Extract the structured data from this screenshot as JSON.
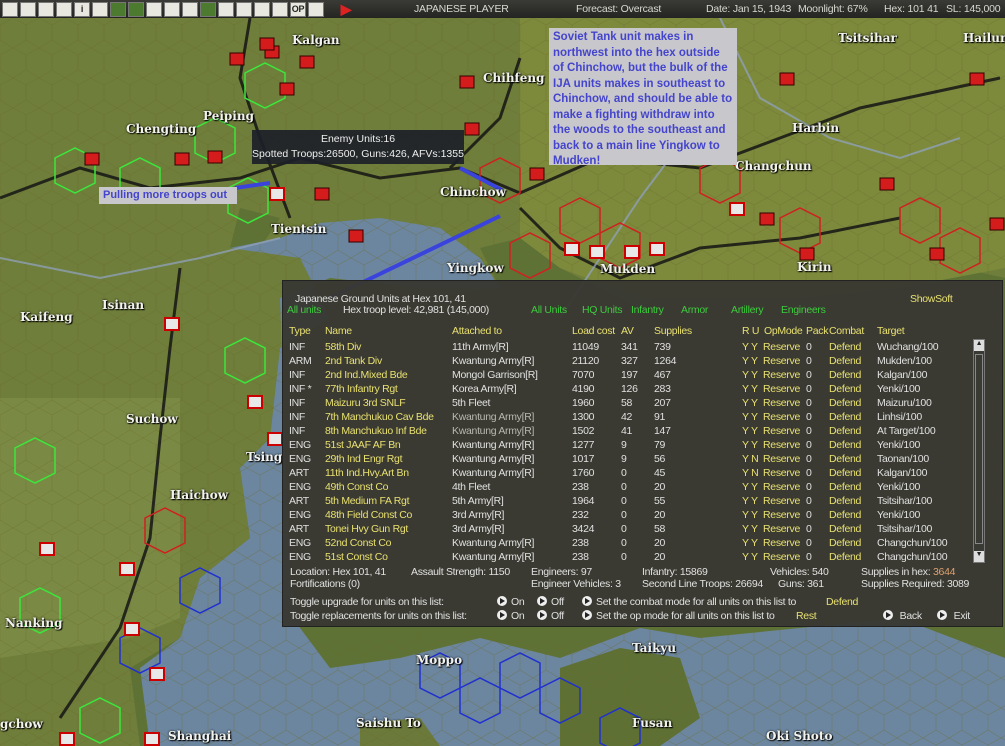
{
  "topbar": {
    "player": "JAPANESE PLAYER",
    "forecast": "Forecast: Overcast",
    "date": "Date: Jan 15, 1943",
    "moonlight": "Moonlight: 67%",
    "hex": "Hex: 101 41",
    "sl": "SL: 145,000",
    "buttons": [
      "unit-list",
      "report",
      "intel",
      "ships",
      "info",
      "japan-flag",
      "air-red",
      "air-blue",
      "flag",
      "infantry",
      "officer",
      "factory",
      "bases",
      "globe",
      "map",
      "op-report",
      "list",
      "cloud",
      "end-turn"
    ]
  },
  "map": {
    "cities": [
      "Kalgan",
      "Chihfeng",
      "Tsitsihar",
      "Hailun",
      "Peiping",
      "Chengting",
      "Harbin",
      "Changchun",
      "Chinchow",
      "Tientsin",
      "Yingkow",
      "Mukden",
      "Kirin",
      "Kaifeng",
      "Isinan",
      "Suchow",
      "Tsing",
      "Haichow",
      "Nanking",
      "Moppo",
      "Taikyu",
      "Saishu To",
      "Fusan",
      "Oki Shoto",
      "Shanghai",
      "gchow"
    ],
    "tooltip": {
      "line1": "Enemy Units:16",
      "line2": "Spotted Troops:26500, Guns:426, AFVs:1355"
    },
    "note_main": "Soviet Tank unit makes in northwest into the hex outside of Chinchow, but the bulk of the IJA units makes in southeast to Chinchow, and should be able to make a fighting withdraw into the woods to the southeast and back to a main line Yingkow to Mudken!",
    "note_left": "Pulling more troops out"
  },
  "panel": {
    "title": "Japanese Ground Units at Hex 101, 41",
    "all_units_left": "All units",
    "troop_level": "Hex troop level: 42,981  (145,000)",
    "filters": [
      "All Units",
      "HQ Units",
      "Infantry",
      "Armor",
      "Artillery",
      "Engineers"
    ],
    "show_soft": "ShowSoft",
    "headers": {
      "type": "Type",
      "name": "Name",
      "attached": "Attached to",
      "load": "Load cost",
      "av": "AV",
      "supplies": "Supplies",
      "ru": "R U",
      "opmode": "OpMode",
      "pack": "Pack",
      "combat": "Combat",
      "target": "Target"
    },
    "rows": [
      {
        "type": "INF",
        "name": "58th Div",
        "att": "11th Army[R]",
        "load": "11049",
        "av": "341",
        "sup": "739",
        "ru": "Y Y",
        "op": "Reserve",
        "pack": "0",
        "combat": "Defend",
        "target": "Wuchang/100"
      },
      {
        "type": "ARM",
        "name": "2nd Tank Div",
        "att": "Kwantung Army[R]",
        "load": "21120",
        "av": "327",
        "sup": "1264",
        "ru": "Y Y",
        "op": "Reserve",
        "pack": "0",
        "combat": "Defend",
        "target": "Mukden/100"
      },
      {
        "type": "INF",
        "name": "2nd Ind.Mixed Bde",
        "att": "Mongol Garrison[R]",
        "load": "7070",
        "av": "197",
        "sup": "467",
        "ru": "Y Y",
        "op": "Reserve",
        "pack": "0",
        "combat": "Defend",
        "target": "Kalgan/100"
      },
      {
        "type": "INF *",
        "name": "77th Infantry Rgt",
        "att": "Korea Army[R]",
        "load": "4190",
        "av": "126",
        "sup": "283",
        "ru": "Y Y",
        "op": "Reserve",
        "pack": "0",
        "combat": "Defend",
        "target": "Yenki/100"
      },
      {
        "type": "INF",
        "name": "Maizuru 3rd SNLF",
        "att": "5th Fleet",
        "load": "1960",
        "av": "58",
        "sup": "207",
        "ru": "Y Y",
        "op": "Reserve",
        "pack": "0",
        "combat": "Defend",
        "target": "Maizuru/100"
      },
      {
        "type": "INF",
        "name": "7th Manchukuo Cav Bde",
        "att": "Kwantung Army[R]",
        "load": "1300",
        "av": "42",
        "sup": "91",
        "ru": "Y Y",
        "op": "Reserve",
        "pack": "0",
        "combat": "Defend",
        "target": "Linhsi/100",
        "dim": true
      },
      {
        "type": "INF",
        "name": "8th Manchukuo Inf Bde",
        "att": "Kwantung Army[R]",
        "load": "1502",
        "av": "41",
        "sup": "147",
        "ru": "Y Y",
        "op": "Reserve",
        "pack": "0",
        "combat": "Defend",
        "target": "At Target/100",
        "dim": true
      },
      {
        "type": "ENG",
        "name": "51st JAAF AF Bn",
        "att": "Kwantung Army[R]",
        "load": "1277",
        "av": "9",
        "sup": "79",
        "ru": "Y Y",
        "op": "Reserve",
        "pack": "0",
        "combat": "Defend",
        "target": "Yenki/100"
      },
      {
        "type": "ENG",
        "name": "29th Ind Engr Rgt",
        "att": "Kwantung Army[R]",
        "load": "1017",
        "av": "9",
        "sup": "56",
        "ru": "Y N",
        "op": "Reserve",
        "pack": "0",
        "combat": "Defend",
        "target": "Taonan/100"
      },
      {
        "type": "ART",
        "name": "11th Ind.Hvy.Art Bn",
        "att": "Kwantung Army[R]",
        "load": "1760",
        "av": "0",
        "sup": "45",
        "ru": "Y N",
        "op": "Reserve",
        "pack": "0",
        "combat": "Defend",
        "target": "Kalgan/100"
      },
      {
        "type": "ENG",
        "name": "49th Const Co",
        "att": "4th Fleet",
        "load": "238",
        "av": "0",
        "sup": "20",
        "ru": "Y Y",
        "op": "Reserve",
        "pack": "0",
        "combat": "Defend",
        "target": "Yenki/100"
      },
      {
        "type": "ART",
        "name": "5th Medium FA Rgt",
        "att": "5th Army[R]",
        "load": "1964",
        "av": "0",
        "sup": "55",
        "ru": "Y Y",
        "op": "Reserve",
        "pack": "0",
        "combat": "Defend",
        "target": "Tsitsihar/100"
      },
      {
        "type": "ENG",
        "name": "48th Field Const Co",
        "att": "3rd Army[R]",
        "load": "232",
        "av": "0",
        "sup": "20",
        "ru": "Y Y",
        "op": "Reserve",
        "pack": "0",
        "combat": "Defend",
        "target": "Yenki/100"
      },
      {
        "type": "ART",
        "name": "Tonei Hvy Gun Rgt",
        "att": "3rd Army[R]",
        "load": "3424",
        "av": "0",
        "sup": "58",
        "ru": "Y Y",
        "op": "Reserve",
        "pack": "0",
        "combat": "Defend",
        "target": "Tsitsihar/100"
      },
      {
        "type": "ENG",
        "name": "52nd Const Co",
        "att": "Kwantung Army[R]",
        "load": "238",
        "av": "0",
        "sup": "20",
        "ru": "Y Y",
        "op": "Reserve",
        "pack": "0",
        "combat": "Defend",
        "target": "Changchun/100"
      },
      {
        "type": "ENG",
        "name": "51st Const Co",
        "att": "Kwantung Army[R]",
        "load": "238",
        "av": "0",
        "sup": "20",
        "ru": "Y Y",
        "op": "Reserve",
        "pack": "0",
        "combat": "Defend",
        "target": "Changchun/100"
      }
    ],
    "summary": {
      "location": "Location: Hex 101, 41",
      "assault": "Assault Strength: 1150",
      "engineers": "Engineers: 97",
      "infantry": "Infantry: 15869",
      "vehicles": "Vehicles: 540",
      "supplies_in_hex_label": "Supplies in hex:",
      "supplies_in_hex": "3644",
      "fortifications": "Fortifications (0)",
      "eng_vehicles": "Engineer Vehicles: 3",
      "second_line": "Second Line Troops: 26694",
      "guns": "Guns: 361",
      "supplies_required": "Supplies Required: 3089"
    },
    "controls": {
      "toggle_upgrade": "Toggle upgrade for units on this list:",
      "toggle_repl": "Toggle replacements for units on this list:",
      "on": "On",
      "off": "Off",
      "set_combat": "Set the combat mode for all units on this list to",
      "combat_value": "Defend",
      "set_op": "Set the op mode for all units on this list to",
      "op_value": "Rest",
      "back": "Back",
      "exit": "Exit"
    }
  }
}
